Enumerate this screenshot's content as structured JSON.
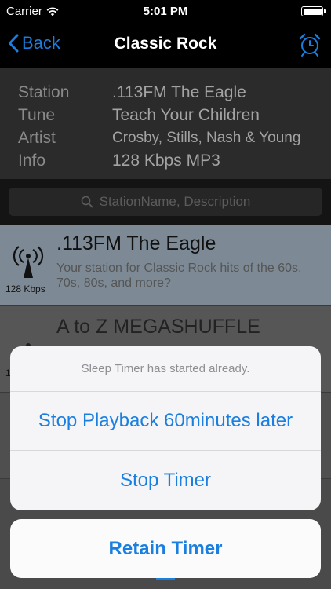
{
  "status_bar": {
    "carrier": "Carrier",
    "time": "5:01 PM",
    "wifi_icon": "wifi-icon",
    "battery_icon": "battery-icon"
  },
  "nav": {
    "back_label": "Back",
    "title": "Classic Rock",
    "alarm_icon": "alarm-clock-icon",
    "accent": "#1a7fe0"
  },
  "info": {
    "rows": [
      {
        "key": "Station",
        "value": ".113FM The Eagle"
      },
      {
        "key": "Tune",
        "value": "Teach Your Children"
      },
      {
        "key": "Artist",
        "value": "Crosby, Stills, Nash & Young"
      },
      {
        "key": "Info",
        "value": "128 Kbps MP3"
      }
    ]
  },
  "search": {
    "placeholder": "StationName, Description"
  },
  "stations": [
    {
      "name": ".113FM The Eagle",
      "description": "Your station for Classic Rock hits of the 60s, 70s, 80s, and more?",
      "bitrate": "128 Kbps"
    },
    {
      "name": "A to Z MEGASHUFFLE",
      "description": "",
      "bitrate": "1"
    },
    {
      "name": "",
      "description": "",
      "bitrate": ""
    }
  ],
  "action_sheet": {
    "message": "Sleep Timer has started already.",
    "actions": [
      "Stop Playback 60minutes later",
      "Stop Timer"
    ],
    "cancel": "Retain Timer"
  }
}
